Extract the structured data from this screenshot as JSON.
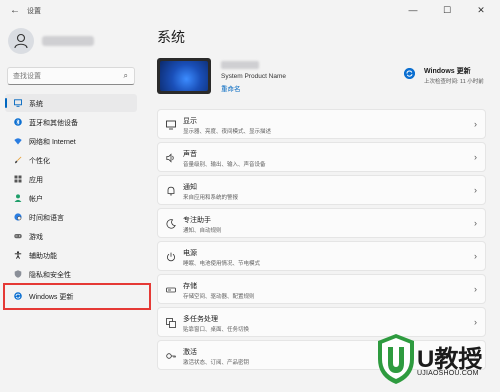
{
  "window": {
    "title": "设置",
    "back_glyph": "←",
    "minimize_glyph": "—",
    "maximize_glyph": "☐",
    "close_glyph": "✕"
  },
  "search": {
    "placeholder": "查找设置",
    "icon": "search-icon"
  },
  "sidebar": {
    "items": [
      {
        "label": "系统",
        "icon": "monitor-icon",
        "active": true
      },
      {
        "label": "蓝牙和其他设备",
        "icon": "bluetooth-icon"
      },
      {
        "label": "网络和 Internet",
        "icon": "wifi-icon"
      },
      {
        "label": "个性化",
        "icon": "brush-icon"
      },
      {
        "label": "应用",
        "icon": "apps-icon"
      },
      {
        "label": "帐户",
        "icon": "account-icon"
      },
      {
        "label": "时间和语言",
        "icon": "globe-clock-icon"
      },
      {
        "label": "游戏",
        "icon": "gamepad-icon"
      },
      {
        "label": "辅助功能",
        "icon": "accessibility-icon"
      },
      {
        "label": "隐私和安全性",
        "icon": "shield-icon"
      },
      {
        "label": "Windows 更新",
        "icon": "windows-update-icon"
      }
    ]
  },
  "main": {
    "title": "系统",
    "device": {
      "model": "System Product Name",
      "rename_label": "重命名"
    },
    "update": {
      "title": "Windows 更新",
      "subtitle": "上次检查时间: 11 小时前"
    },
    "cards": [
      {
        "title": "显示",
        "subtitle": "显示器、亮度、夜间模式、显示描述",
        "icon": "display-icon"
      },
      {
        "title": "声音",
        "subtitle": "音量级别、输出、输入、声音设备",
        "icon": "speaker-icon"
      },
      {
        "title": "通知",
        "subtitle": "来自应用和系统的警报",
        "icon": "bell-icon"
      },
      {
        "title": "专注助手",
        "subtitle": "通知、自动规则",
        "icon": "moon-icon"
      },
      {
        "title": "电源",
        "subtitle": "睡眠、电池使用情况、节电模式",
        "icon": "power-icon"
      },
      {
        "title": "存储",
        "subtitle": "存储空间、驱动器、配置规则",
        "icon": "storage-icon"
      },
      {
        "title": "多任务处理",
        "subtitle": "贴靠窗口、桌面、任务切换",
        "icon": "multitask-icon"
      },
      {
        "title": "激活",
        "subtitle": "激活状态、订阅、产品密钥",
        "icon": "key-icon"
      }
    ],
    "chevron": "›"
  },
  "watermark": {
    "text": "U教授",
    "url": "UJIAOSHOU.COM"
  },
  "colors": {
    "accent": "#0067c0",
    "highlight": "#e53935",
    "watermark_green": "#2e9b3f"
  }
}
